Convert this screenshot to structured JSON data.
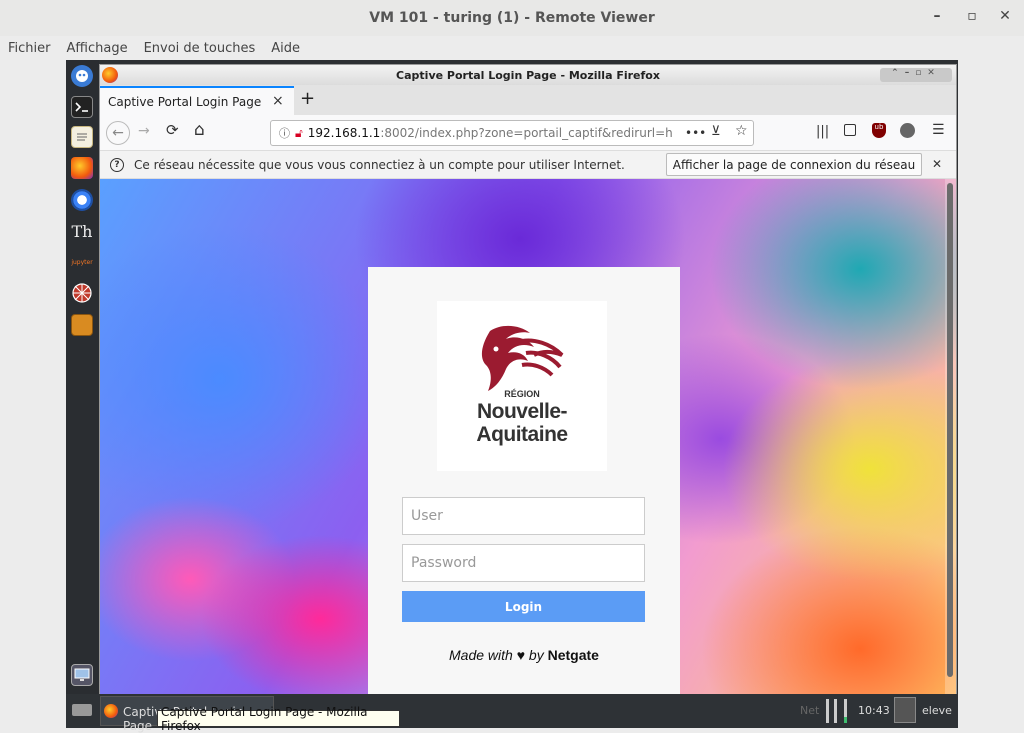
{
  "viewer": {
    "title": "VM 101 - turing (1) - Remote Viewer",
    "menu": [
      "Fichier",
      "Affichage",
      "Envoi de touches",
      "Aide"
    ],
    "controls": {
      "minimize": "–",
      "maximize": "▫",
      "close": "✕"
    }
  },
  "dock": {
    "items": [
      "app-icon",
      "terminal-icon",
      "text-editor-icon",
      "firefox-icon",
      "chromium-icon",
      "thonny-icon",
      "jupyter-icon",
      "network-icon",
      "archive-icon"
    ],
    "thonny_label": "Th",
    "jupyter_label": "jupyter",
    "show_desktop": "desktop-icon"
  },
  "firefox": {
    "window_title": "Captive Portal Login Page - Mozilla Firefox",
    "tab_label": "Captive Portal Login Page",
    "tab_close": "×",
    "new_tab": "+",
    "url_host": "192.168.1.1",
    "url_rest": ":8002/index.php?zone=portail_captif&redirurl=h",
    "url_more": "•••",
    "notification": "Ce réseau nécessite que vous vous connectiez à un compte pour utiliser Internet.",
    "notification_button": "Afficher la page de connexion du réseau",
    "notification_close": "✕",
    "nav": {
      "back": "←",
      "forward": "→",
      "reload": "⟳",
      "home": "⌂",
      "menu": "☰"
    }
  },
  "login": {
    "logo_region": "RÉGION",
    "logo_line1": "Nouvelle-",
    "logo_line2": "Aquitaine",
    "user_placeholder": "User",
    "password_placeholder": "Password",
    "button": "Login",
    "footer_prefix": "Made with",
    "footer_heart": "♥",
    "footer_by": "by",
    "footer_brand": "Netgate"
  },
  "taskbar": {
    "task_label": "Captive Portal Login Page",
    "tooltip": "Captive Portal Login Page - Mozilla Firefox",
    "net_label": "Net",
    "clock": "10:43",
    "user": "eleve"
  },
  "colors": {
    "login_button": "#5b9cf5",
    "logo_red": "#9b1b30",
    "firefox_accent": "#0a84ff"
  }
}
